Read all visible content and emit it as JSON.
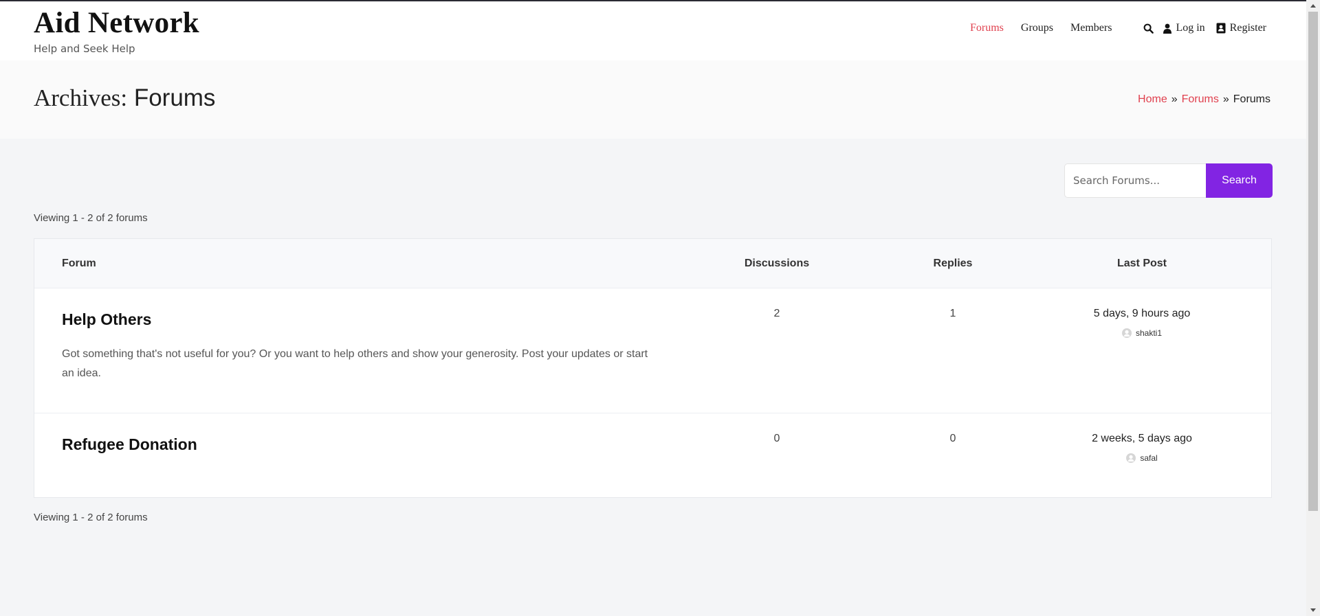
{
  "site": {
    "title": "Aid Network",
    "tagline": "Help and Seek Help"
  },
  "nav": {
    "items": [
      {
        "label": "Forums",
        "active": true
      },
      {
        "label": "Groups",
        "active": false
      },
      {
        "label": "Members",
        "active": false
      }
    ],
    "login_label": "Log in",
    "register_label": "Register",
    "icons": [
      "search-icon",
      "user-icon",
      "address-book-icon"
    ]
  },
  "page": {
    "title_prefix": "Archives:",
    "title_name": "Forums"
  },
  "breadcrumb": {
    "home": "Home",
    "separator": "»",
    "parent": "Forums",
    "current": "Forums"
  },
  "search": {
    "placeholder": "Search Forums...",
    "button_label": "Search"
  },
  "pagination": {
    "top_text": "Viewing 1 - 2 of 2 forums",
    "bottom_text": "Viewing 1 - 2 of 2 forums"
  },
  "table": {
    "headers": {
      "forum": "Forum",
      "discussions": "Discussions",
      "replies": "Replies",
      "last_post": "Last Post"
    },
    "rows": [
      {
        "name": "Help Others",
        "description": "Got something that's not useful for you? Or you want to help others and show your generosity. Post your updates or start an idea.",
        "discussions": "2",
        "replies": "1",
        "last_post_time": "5 days, 9 hours ago",
        "last_post_user": "shakti1"
      },
      {
        "name": "Refugee Donation",
        "description": "",
        "discussions": "0",
        "replies": "0",
        "last_post_time": "2 weeks, 5 days ago",
        "last_post_user": "safal"
      }
    ]
  },
  "colors": {
    "accent": "#e0404e",
    "button": "#8224e3",
    "background": "#f4f5f7",
    "header_bg": "#ffffff"
  }
}
